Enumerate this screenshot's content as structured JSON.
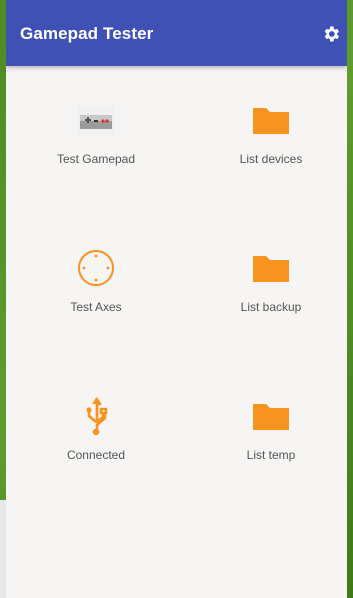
{
  "app": {
    "title": "Gamepad Tester"
  },
  "icons": {
    "settings": "gear-icon",
    "gamepad": "gamepad-icon",
    "folder": "folder-icon",
    "axes": "crosshair-circle-icon",
    "usb": "usb-icon"
  },
  "colors": {
    "appbar": "#3f51b5",
    "accent": "#f7931e",
    "background": "#f6f5f3",
    "label": "#555555"
  },
  "tiles": [
    {
      "label": "Test Gamepad"
    },
    {
      "label": "List devices"
    },
    {
      "label": "Test Axes"
    },
    {
      "label": "List backup"
    },
    {
      "label": "Connected"
    },
    {
      "label": "List temp"
    }
  ]
}
